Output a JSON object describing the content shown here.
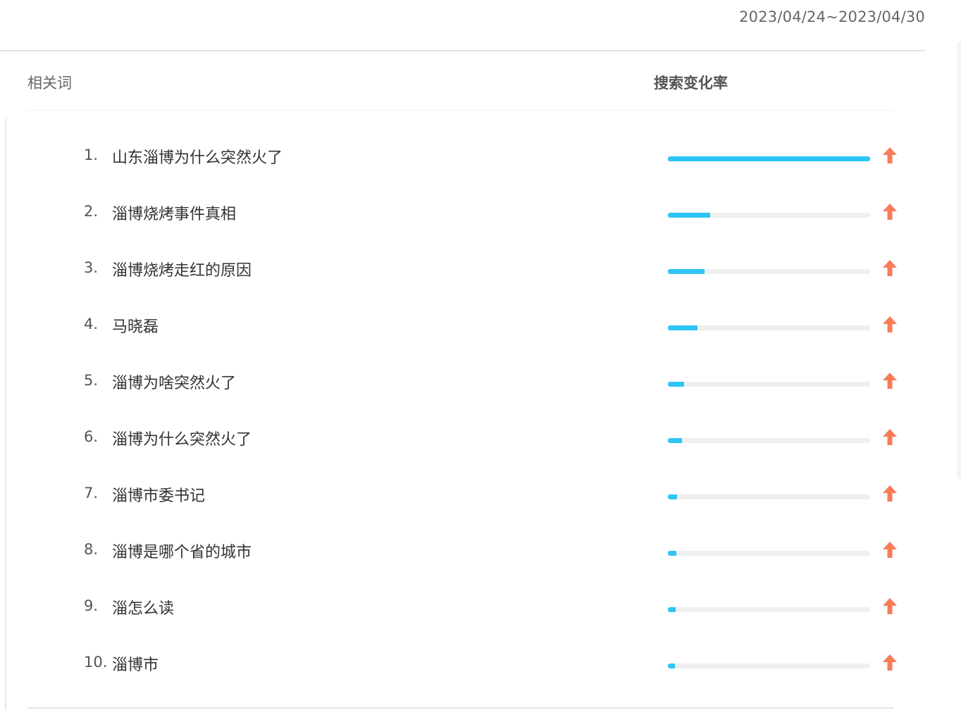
{
  "date_range": "2023/04/24~2023/04/30",
  "header": {
    "related_words": "相关词",
    "search_change_rate": "搜索变化率"
  },
  "colors": {
    "bar": "#2cc5f5",
    "track": "#efefef",
    "arrow_up": "#f97b5a"
  },
  "items": [
    {
      "rank": "1.",
      "term": "山东淄博为什么突然火了",
      "rate": 1.0,
      "trend": "up",
      "trend_icon": "arrow-up-icon"
    },
    {
      "rank": "2.",
      "term": "淄博烧烤事件真相",
      "rate": 0.21,
      "trend": "up",
      "trend_icon": "arrow-up-icon"
    },
    {
      "rank": "3.",
      "term": "淄博烧烤走红的原因",
      "rate": 0.18,
      "trend": "up",
      "trend_icon": "arrow-up-icon"
    },
    {
      "rank": "4.",
      "term": "马晓磊",
      "rate": 0.146,
      "trend": "up",
      "trend_icon": "arrow-up-icon"
    },
    {
      "rank": "5.",
      "term": "淄博为啥突然火了",
      "rate": 0.08,
      "trend": "up",
      "trend_icon": "arrow-up-icon"
    },
    {
      "rank": "6.",
      "term": "淄博为什么突然火了",
      "rate": 0.07,
      "trend": "up",
      "trend_icon": "arrow-up-icon"
    },
    {
      "rank": "7.",
      "term": "淄博市委书记",
      "rate": 0.045,
      "trend": "up",
      "trend_icon": "arrow-up-icon"
    },
    {
      "rank": "8.",
      "term": "淄博是哪个省的城市",
      "rate": 0.042,
      "trend": "up",
      "trend_icon": "arrow-up-icon"
    },
    {
      "rank": "9.",
      "term": "淄怎么读",
      "rate": 0.038,
      "trend": "up",
      "trend_icon": "arrow-up-icon"
    },
    {
      "rank": "10.",
      "term": "淄博市",
      "rate": 0.035,
      "trend": "up",
      "trend_icon": "arrow-up-icon"
    }
  ]
}
